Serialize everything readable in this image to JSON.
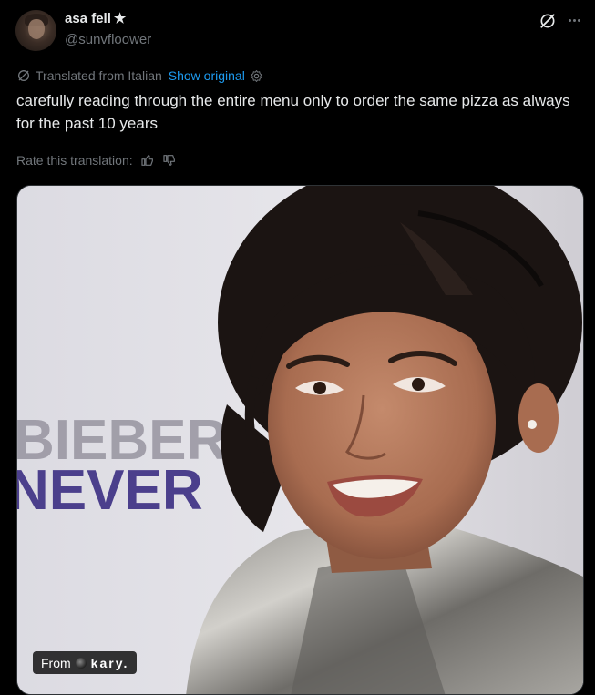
{
  "author": {
    "display_name": "asa fell",
    "badge_icon": "star-icon",
    "handle": "@sunvfloower"
  },
  "header_actions": {
    "grok_icon": "grok-icon",
    "more_icon": "more-options-icon"
  },
  "translation": {
    "label": "Translated from Italian",
    "show_original": "Show original",
    "link_color": "#1d9bf0"
  },
  "post": {
    "text": "carefully reading through the entire menu only to order the same pizza as always for the past 10 years"
  },
  "rating": {
    "label": "Rate this translation:",
    "thumbs_up_icon": "thumbs-up-icon",
    "thumbs_down_icon": "thumbs-down-icon"
  },
  "media": {
    "backdrop_text_line1": "BIEBER",
    "backdrop_text_line2": "NEVER",
    "caption_prefix": "From",
    "caption_user": "kary."
  },
  "colors": {
    "background": "#000000",
    "primary_text": "#e7e9ea",
    "secondary_text": "#71767b",
    "backdrop_letters": "#4b3f8c"
  }
}
